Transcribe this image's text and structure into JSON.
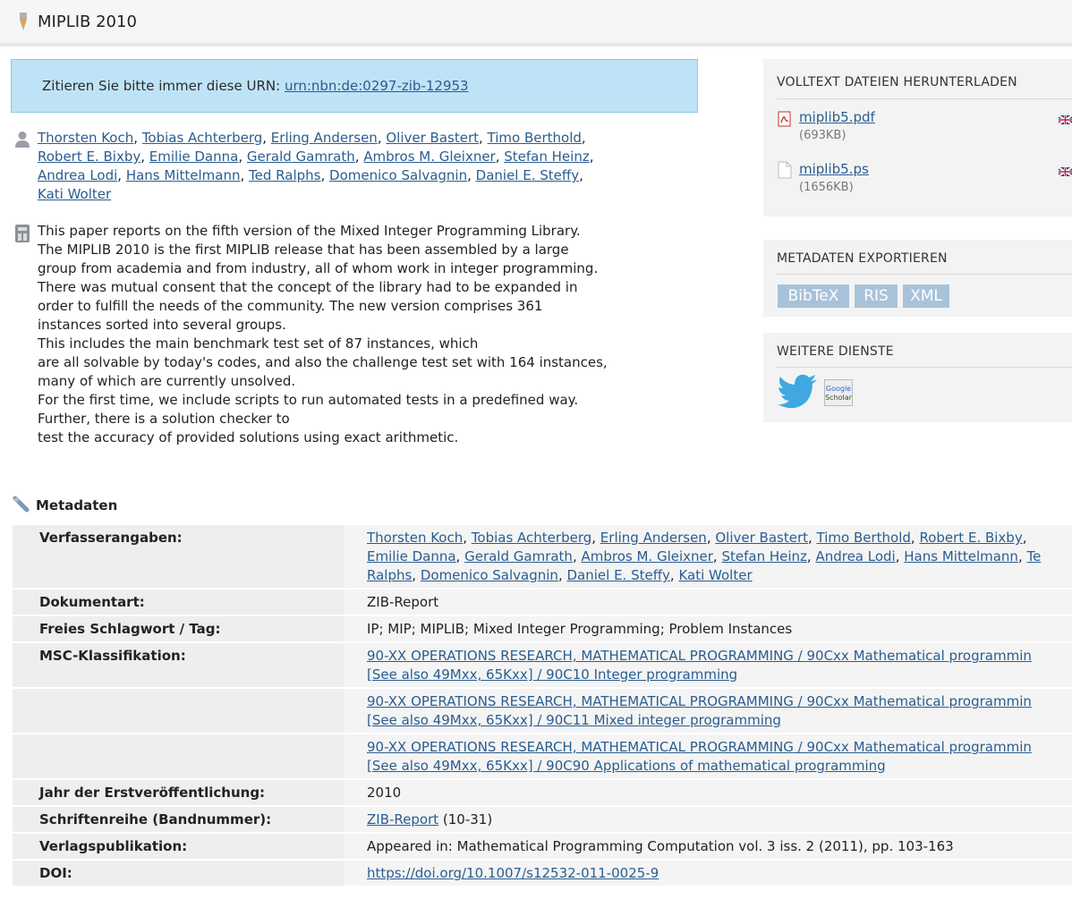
{
  "title": "MIPLIB 2010",
  "urn": {
    "prefix": "Zitieren Sie bitte immer diese URN: ",
    "value": "urn:nbn:de:0297-zib-12953"
  },
  "authors_lines": [
    [
      "Thorsten Koch",
      "Tobias Achterberg",
      "Erling Andersen",
      "Oliver Bastert",
      "Timo Berthold"
    ],
    [
      "Robert E. Bixby",
      "Emilie Danna",
      "Gerald Gamrath",
      "Ambros M. Gleixner",
      "Stefan Heinz"
    ],
    [
      "Andrea Lodi",
      "Hans Mittelmann",
      "Ted Ralphs",
      "Domenico Salvagnin",
      "Daniel E. Steffy"
    ],
    [
      "Kati Wolter"
    ]
  ],
  "abstract_lines": [
    "This paper reports on the fifth version of the Mixed Integer Programming Library.",
    "The MIPLIB 2010 is the first MIPLIB release that has been assembled by a large",
    "group from academia and from industry, all of whom work in integer programming.",
    "There was mutual consent that the concept of the library had to be expanded in",
    "order to fulfill the needs of the community. The new version comprises 361",
    "instances sorted into several groups.",
    "This includes the main benchmark test set of 87 instances, which",
    "are all solvable by today's codes, and also the challenge test set with 164 instances,",
    "many of which are currently unsolved.",
    "For the first time, we include scripts to run automated tests in a predefined way.",
    "Further, there is a solution checker to",
    "test the accuracy of provided solutions using exact arithmetic."
  ],
  "downloads": {
    "heading": "VOLLTEXT DATEIEN HERUNTERLADEN",
    "files": [
      {
        "name": "miplib5.pdf",
        "size": "(693KB)",
        "icon": "pdf-icon"
      },
      {
        "name": "miplib5.ps",
        "size": "(1656KB)",
        "icon": "document-icon"
      }
    ]
  },
  "export": {
    "heading": "METADATEN EXPORTIEREN",
    "buttons": [
      "BibTeX",
      "RIS",
      "XML"
    ]
  },
  "services": {
    "heading": "WEITERE DIENSTE",
    "google_scholar_logo": [
      "Google",
      "Scholar"
    ]
  },
  "metadata": {
    "heading": "Metadaten",
    "authors_label": "Verfasserangaben:",
    "authors_lines": [
      [
        "Thorsten Koch",
        "Tobias Achterberg",
        "Erling Andersen",
        "Oliver Bastert",
        "Timo Berthold",
        "Robert E. Bixby"
      ],
      [
        "Emilie Danna",
        "Gerald Gamrath",
        "Ambros M. Gleixner",
        "Stefan Heinz",
        "Andrea Lodi",
        "Hans Mittelmann",
        "Te"
      ],
      [
        "Ralphs",
        "Domenico Salvagnin",
        "Daniel E. Steffy",
        "Kati Wolter"
      ]
    ],
    "doctype_label": "Dokumentart:",
    "doctype": "ZIB-Report",
    "keywords_label": "Freies Schlagwort / Tag:",
    "keywords": "IP; MIP; MIPLIB; Mixed Integer Programming; Problem Instances",
    "msc_label": "MSC-Klassifikation:",
    "msc": [
      [
        "90-XX OPERATIONS RESEARCH, MATHEMATICAL PROGRAMMING / 90Cxx Mathematical programmin",
        "[See also 49Mxx, 65Kxx] / 90C10 Integer programming"
      ],
      [
        "90-XX OPERATIONS RESEARCH, MATHEMATICAL PROGRAMMING / 90Cxx Mathematical programmin",
        "[See also 49Mxx, 65Kxx] / 90C11 Mixed integer programming"
      ],
      [
        "90-XX OPERATIONS RESEARCH, MATHEMATICAL PROGRAMMING / 90Cxx Mathematical programmin",
        "[See also 49Mxx, 65Kxx] / 90C90 Applications of mathematical programming"
      ]
    ],
    "year_label": "Jahr der Erstveröffentlichung:",
    "year": "2010",
    "series_label": "Schriftenreihe (Bandnummer):",
    "series_link": "ZIB-Report",
    "series_number": " (10-31)",
    "publication_label": "Verlagspublikation:",
    "publication": "Appeared in: Mathematical Programming Computation vol. 3 iss. 2 (2011), pp. 103-163",
    "doi_label": "DOI:",
    "doi": "https://doi.org/10.1007/s12532-011-0025-9"
  }
}
